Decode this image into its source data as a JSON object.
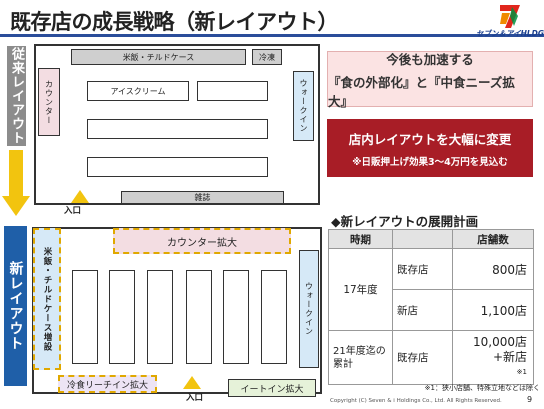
{
  "header": {
    "title": "既存店の成長戦略（新レイアウト）",
    "logo_text": "セブン＆アイHLDGS."
  },
  "labels": {
    "old_layout": "従来レイアウト",
    "new_layout": "新レイアウト"
  },
  "old_store": {
    "rice_chilled": "米飯・チルドケース",
    "frozen": "冷凍",
    "counter": "カウンター",
    "ice_cream": "アイスクリーム",
    "walk_in": "ウォークイン",
    "magazines": "雑誌",
    "entrance": "入口"
  },
  "new_store": {
    "counter_expansion": "カウンター拡大",
    "rice_chilled_expansion": "米飯・チルドケース増設",
    "walk_in": "ウォークイン",
    "frozen_reach_in": "冷食リーチイン拡大",
    "entrance": "入口",
    "eat_in": "イートイン拡大"
  },
  "right_panel": {
    "banner_line1": "今後も加速する",
    "banner_line2": "『食の外部化』と『中食ニーズ拡大』",
    "red_line1": "店内レイアウトを大幅に変更",
    "red_line2": "※日販押上げ効果3～4万円を見込む",
    "plan_title": "◆新レイアウトの展開計画"
  },
  "plan_table": {
    "headers": [
      "時期",
      "",
      "店舗数"
    ],
    "rows": [
      {
        "period": "17年度",
        "type": "既存店",
        "count": "800店"
      },
      {
        "period": "",
        "type": "新店",
        "count": "1,100店"
      },
      {
        "period": "21年度迄の累計",
        "type": "既存店",
        "count": "10,000店",
        "count2": "+新店",
        "note": "※1"
      }
    ]
  },
  "footer": {
    "footnote": "※1：狭小店舗、特殊立地などは除く",
    "copyright": "Copyright (C)  Seven & i Holdings Co., Ltd.  All Rights Reserved.",
    "page": "9"
  },
  "colors": {
    "title_rule": "#2a4d9a",
    "old_label": "#8c8c8c",
    "new_label": "#1f5fa8",
    "arrow": "#f2c40f",
    "red_banner": "#a81d26",
    "pink_banner": "#fbe3e3"
  }
}
